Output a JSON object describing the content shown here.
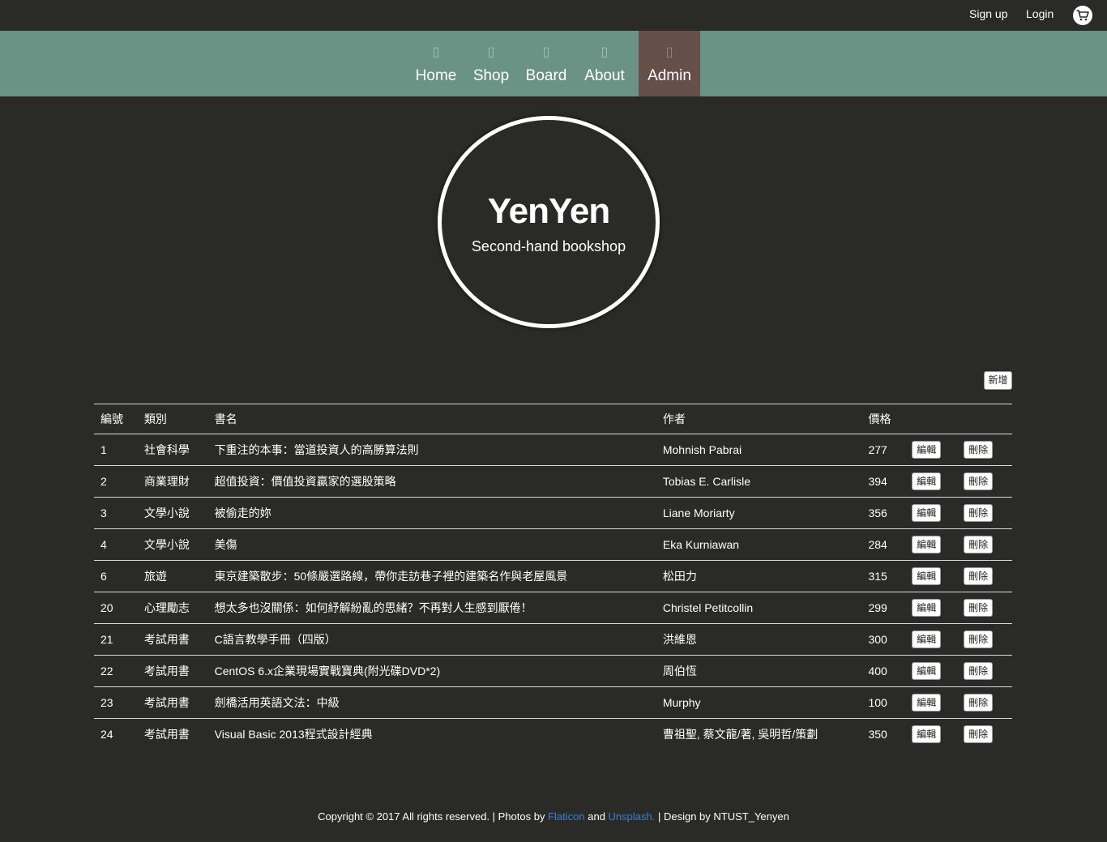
{
  "topbar": {
    "signup_label": "Sign up",
    "login_label": "Login",
    "cart_icon": "cart-icon"
  },
  "nav": {
    "active_color": "#664f48",
    "bar_color": "#6a9285",
    "items": [
      {
        "label": "Home",
        "icon": "home-icon"
      },
      {
        "label": "Shop",
        "icon": "shop-icon"
      },
      {
        "label": "Board",
        "icon": "board-icon"
      },
      {
        "label": "About",
        "icon": "about-icon"
      },
      {
        "label": "Admin",
        "icon": "admin-icon",
        "active": true
      }
    ]
  },
  "hero": {
    "brand": "YenYen",
    "tagline": "Second-hand bookshop"
  },
  "toolbar": {
    "add_label": "新增"
  },
  "table": {
    "headers": {
      "id": "編號",
      "category": "類別",
      "title": "書名",
      "author": "作者",
      "price": "價格"
    },
    "edit_label": "編輯",
    "delete_label": "刪除",
    "rows": [
      {
        "id": "1",
        "category": "社會科學",
        "title": "下重注的本事：當道投資人的高勝算法則",
        "author": "Mohnish Pabrai",
        "price": "277"
      },
      {
        "id": "2",
        "category": "商業理財",
        "title": "超值投資：價值投資贏家的選股策略",
        "author": "Tobias E. Carlisle",
        "price": "394"
      },
      {
        "id": "3",
        "category": "文學小說",
        "title": "被偷走的妳",
        "author": "Liane Moriarty",
        "price": "356"
      },
      {
        "id": "4",
        "category": "文學小說",
        "title": "美傷",
        "author": "Eka Kurniawan",
        "price": "284"
      },
      {
        "id": "6",
        "category": "旅遊",
        "title": "東京建築散步：50條嚴選路線，帶你走訪巷子裡的建築名作與老屋風景",
        "author": "松田力",
        "price": "315"
      },
      {
        "id": "20",
        "category": "心理勵志",
        "title": "想太多也沒關係：如何紓解紛亂的思緒？不再對人生感到厭倦！",
        "author": "Christel Petitcollin",
        "price": "299"
      },
      {
        "id": "21",
        "category": "考試用書",
        "title": "C語言教學手冊（四版）",
        "author": "洪維恩",
        "price": "300"
      },
      {
        "id": "22",
        "category": "考試用書",
        "title": "CentOS 6.x企業現場實戰寶典(附光碟DVD*2)",
        "author": "周伯恆",
        "price": "400"
      },
      {
        "id": "23",
        "category": "考試用書",
        "title": "劍橋活用英語文法：中級",
        "author": "Murphy",
        "price": "100"
      },
      {
        "id": "24",
        "category": "考試用書",
        "title": "Visual Basic 2013程式設計經典",
        "author": "曹祖聖, 蔡文龍/著, 吳明哲/策劃",
        "price": "350"
      }
    ]
  },
  "footer": {
    "prefix": "Copyright © 2017 All rights reserved. | Photos by ",
    "flaticon": "Flaticon",
    "and": " and ",
    "unsplash": "Unsplash.",
    "suffix": " | Design by NTUST_Yenyen"
  }
}
